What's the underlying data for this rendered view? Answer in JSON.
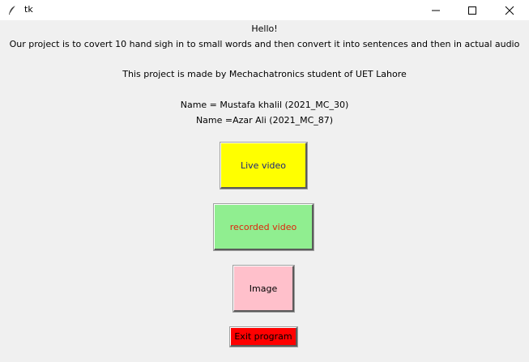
{
  "window": {
    "title": "tk",
    "controls": [
      "minimize-icon",
      "maximize-icon",
      "close-icon"
    ]
  },
  "text": {
    "greeting": "Hello!",
    "description": "Our project is to covert 10 hand sigh in to small words and then convert it into sentences and then in actual audio",
    "credit": "This project is made by Mechachatronics student of UET Lahore",
    "name1": "Name = Mustafa khalil (2021_MC_30)",
    "name2": "Name =Azar Ali (2021_MC_87)"
  },
  "buttons": {
    "live_video": "Live video",
    "recorded_video": "recorded video",
    "image": "Image",
    "exit": "Exit program"
  },
  "colors": {
    "live_video_bg": "#ffff00",
    "recorded_video_bg": "#90ee90",
    "image_bg": "#ffc0cb",
    "exit_bg": "#ff0000"
  }
}
